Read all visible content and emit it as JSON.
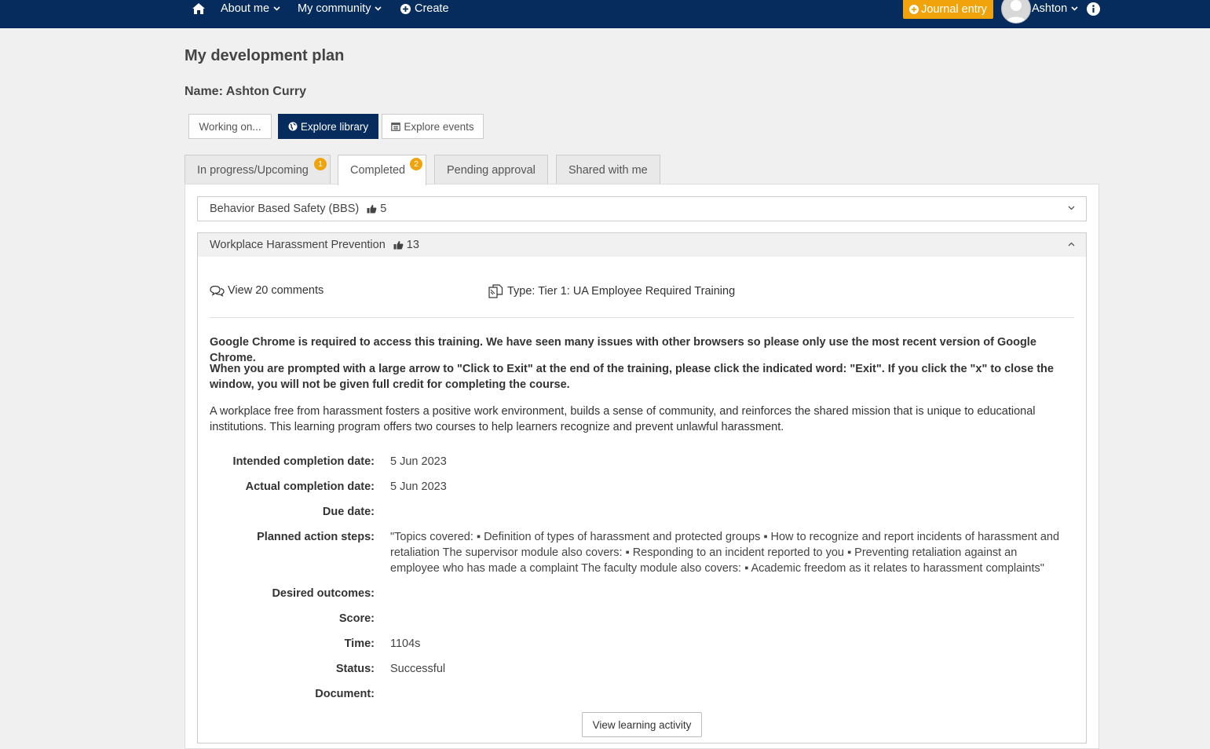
{
  "nav": {
    "about_me": "About me",
    "my_community": "My community",
    "create": "Create",
    "journal_entry": "Journal entry",
    "user_name": "Ashton"
  },
  "page": {
    "title": "My development plan",
    "name_line": "Name: Ashton Curry"
  },
  "actions": {
    "working_on": "Working on...",
    "explore_library": "Explore library",
    "explore_events": "Explore events"
  },
  "tabs": [
    {
      "label": "In progress/Upcoming",
      "badge": "1"
    },
    {
      "label": "Completed",
      "badge": "2"
    },
    {
      "label": "Pending approval"
    },
    {
      "label": "Shared with me"
    }
  ],
  "items": [
    {
      "title": "Behavior Based Safety (BBS)",
      "likes": "5",
      "expanded": false
    },
    {
      "title": "Workplace Harassment Prevention",
      "likes": "13",
      "expanded": true
    }
  ],
  "detail": {
    "comments_link": "View 20 comments",
    "type_text": "Type: Tier 1: UA Employee Required Training",
    "notice_1": "Google Chrome is required to access this training. We have seen many issues with other browsers so please only use the most recent version of Google Chrome.",
    "notice_2": "When you are prompted with a large arrow to \"Click to Exit\" at the end of the training, please click the indicated word: \"Exit\". If you click the \"x\" to close the window, you will not be given full credit for completing the course.",
    "description": "A workplace free from harassment fosters a positive work environment, builds a sense of community, and reinforces the shared mission that is unique to educational institutions. This learning program offers two courses to help learners recognize and prevent unlawful harassment.",
    "fields": {
      "intended_label": "Intended completion date:",
      "intended_value": "5 Jun 2023",
      "actual_label": "Actual completion date:",
      "actual_value": "5 Jun 2023",
      "due_label": "Due date:",
      "due_value": "",
      "planned_label": "Planned action steps:",
      "planned_value": "\"Topics covered: ▪ Definition of types of harassment and protected groups ▪ How to recognize and report incidents of harassment and retaliation The supervisor module also covers: ▪ Responding to an incident reported to you ▪ Preventing retaliation against an employee who has made a complaint The faculty module also covers: ▪ Academic freedom as it relates to harassment complaints\"",
      "outcomes_label": "Desired outcomes:",
      "outcomes_value": "",
      "score_label": "Score:",
      "score_value": "",
      "time_label": "Time:",
      "time_value": "1104s",
      "status_label": "Status:",
      "status_value": "Successful",
      "document_label": "Document:",
      "document_value": ""
    },
    "activity_button": "View learning activity"
  },
  "colors": {
    "navbar": "#062c5d",
    "accent": "#f0a30a"
  }
}
